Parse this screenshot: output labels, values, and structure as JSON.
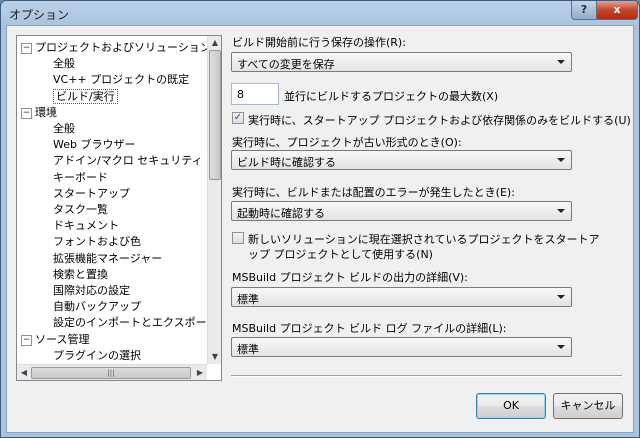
{
  "window": {
    "title": "オプション",
    "help_label": "?",
    "close_label": "x"
  },
  "tree": {
    "items": [
      {
        "label": "プロジェクトおよびソリューション",
        "level": 0,
        "expander": "−"
      },
      {
        "label": "全般",
        "level": 1
      },
      {
        "label": "VC++ プロジェクトの既定",
        "level": 1
      },
      {
        "label": "ビルド/実行",
        "level": 1,
        "selected": true
      },
      {
        "label": "環境",
        "level": 0,
        "expander": "−"
      },
      {
        "label": "全般",
        "level": 1
      },
      {
        "label": "Web ブラウザー",
        "level": 1
      },
      {
        "label": "アドイン/マクロ セキュリティ",
        "level": 1
      },
      {
        "label": "キーボード",
        "level": 1
      },
      {
        "label": "スタートアップ",
        "level": 1
      },
      {
        "label": "タスク一覧",
        "level": 1
      },
      {
        "label": "ドキュメント",
        "level": 1
      },
      {
        "label": "フォントおよび色",
        "level": 1
      },
      {
        "label": "拡張機能マネージャー",
        "level": 1
      },
      {
        "label": "検索と置換",
        "level": 1
      },
      {
        "label": "国際対応の設定",
        "level": 1
      },
      {
        "label": "自動バックアップ",
        "level": 1
      },
      {
        "label": "設定のインポートとエクスポート",
        "level": 1
      },
      {
        "label": "ソース管理",
        "level": 0,
        "expander": "−"
      },
      {
        "label": "プラグインの選択",
        "level": 1
      }
    ],
    "hscroll_grip": "|||"
  },
  "settings": {
    "save_before_build_label": "ビルド開始前に行う保存の操作(R):",
    "save_before_build_value": "すべての変更を保存",
    "parallel_builds_value": "8",
    "parallel_builds_label": "並行にビルドするプロジェクトの最大数(X)",
    "build_startup_only_label": "実行時に、スタートアップ プロジェクトおよび依存関係のみをビルドする(U)",
    "build_startup_only_checked": true,
    "out_of_date_label": "実行時に、プロジェクトが古い形式のとき(O):",
    "out_of_date_value": "ビルド時に確認する",
    "build_error_label": "実行時に、ビルドまたは配置のエラーが発生したとき(E):",
    "build_error_value": "起動時に確認する",
    "new_solution_label_line1": "新しいソリューションに現在選択されているプロジェクトをスタートア",
    "new_solution_label_line2": "ップ プロジェクトとして使用する(N)",
    "new_solution_checked": false,
    "output_verbosity_label": "MSBuild プロジェクト ビルドの出力の詳細(V):",
    "output_verbosity_value": "標準",
    "log_verbosity_label": "MSBuild プロジェクト ビルド ログ ファイルの詳細(L):",
    "log_verbosity_value": "標準"
  },
  "buttons": {
    "ok_label": "OK",
    "cancel_label": "キャンセル"
  },
  "colors": {
    "titlebar": "#bcd2e8",
    "close": "#c7442a",
    "accent": "#3c7fb1"
  }
}
